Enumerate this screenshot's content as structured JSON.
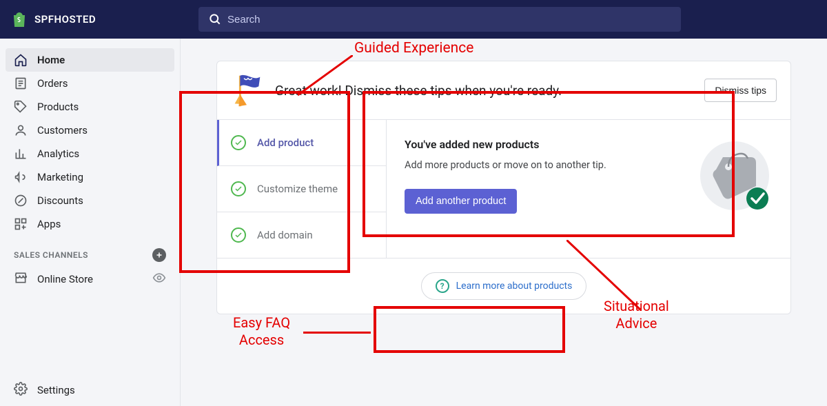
{
  "header": {
    "brand": "SPFHOSTED",
    "search_placeholder": "Search"
  },
  "sidebar": {
    "items": [
      {
        "label": "Home"
      },
      {
        "label": "Orders"
      },
      {
        "label": "Products"
      },
      {
        "label": "Customers"
      },
      {
        "label": "Analytics"
      },
      {
        "label": "Marketing"
      },
      {
        "label": "Discounts"
      },
      {
        "label": "Apps"
      }
    ],
    "channels_head": "SALES CHANNELS",
    "channel_label": "Online Store",
    "settings_label": "Settings"
  },
  "card": {
    "headline": "Great work! Dismiss these tips when you're ready.",
    "dismiss": "Dismiss tips",
    "guide": [
      {
        "label": "Add product"
      },
      {
        "label": "Customize theme"
      },
      {
        "label": "Add domain"
      }
    ],
    "detail": {
      "title": "You've added new products",
      "desc": "Add more products or move on to another tip.",
      "cta": "Add another product"
    },
    "learn": "Learn more about products"
  },
  "annotations": {
    "guided": "Guided Experience",
    "situational": "Situational\nAdvice",
    "faq": "Easy FAQ\nAccess"
  }
}
